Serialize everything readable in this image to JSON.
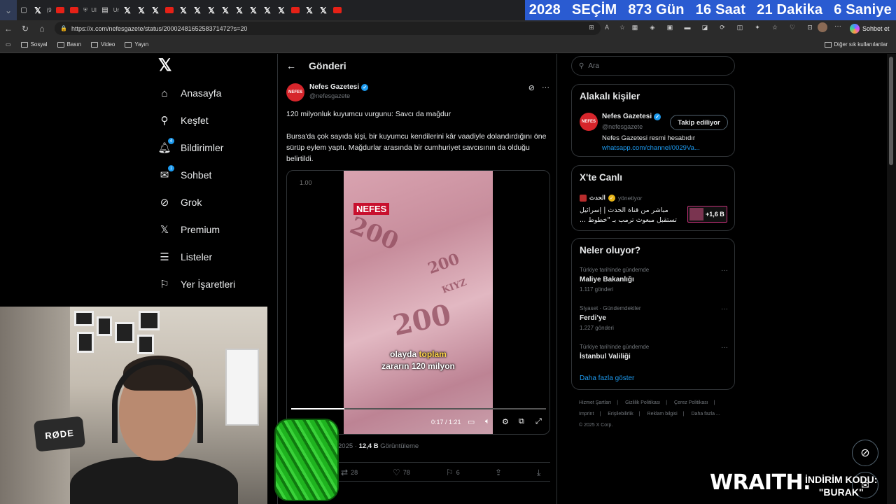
{
  "browser": {
    "tab_icon_count": 22,
    "countdown": [
      "2028",
      "SEÇİM",
      "873 Gün",
      "16 Saat",
      "21 Dakika",
      "6 Saniye"
    ],
    "url": "https://x.com/nefesgazete/status/2000248165258371472?s=20",
    "chat_label": "Sohbet et",
    "bookmarks": [
      "Sosyal",
      "Basın",
      "Video",
      "Yayın"
    ],
    "bookmarks_right": "Diğer sık kullanılanlar",
    "tab_labels": [
      "Ul",
      "Ur"
    ]
  },
  "nav": {
    "items": [
      {
        "label": "Anasayfa",
        "icon": "home-icon"
      },
      {
        "label": "Keşfet",
        "icon": "search-icon"
      },
      {
        "label": "Bildirimler",
        "icon": "bell-icon",
        "badge": "4"
      },
      {
        "label": "Sohbet",
        "icon": "mail-icon",
        "badge": "1"
      },
      {
        "label": "Grok",
        "icon": "grok-icon"
      },
      {
        "label": "Premium",
        "icon": "x-icon"
      },
      {
        "label": "Listeler",
        "icon": "list-icon"
      },
      {
        "label": "Yer İşaretleri",
        "icon": "bookmark-icon"
      }
    ]
  },
  "post": {
    "header_title": "Gönderi",
    "author_name": "Nefes Gazetesi",
    "author_handle": "@nefesgazete",
    "avatar_text": "NEFES",
    "headline": "120 milyonluk kuyumcu vurgunu: Savcı da mağdur",
    "body": "Bursa'da çok sayıda kişi, bir kuyumcu kendilerini kâr vaadiyle dolandırdığını öne sürüp eylem yaptı. Mağdurlar arasında bir cumhuriyet savcısının da olduğu belirtildi.",
    "video": {
      "corner_number": "1.00",
      "logo": "NEFES",
      "caption_pre": "olayda ",
      "caption_hl": "toplam",
      "caption_line2": "zararın 120 milyon",
      "time": "0:17 / 1:21",
      "progress": 0.21,
      "bill_numbers": [
        "200",
        "200",
        "200",
        "KIYZ"
      ]
    },
    "date_fragment": "2025 · ",
    "views_count": "12,4 B",
    "views_label": "Görüntüleme",
    "stats": {
      "retweets": "28",
      "likes": "78",
      "bookmarks": "6"
    }
  },
  "sidebar": {
    "search_placeholder": "Ara",
    "related_title": "Alakalı kişiler",
    "related": {
      "name": "Nefes Gazetesi",
      "handle": "@nefesgazete",
      "follow_label": "Takip ediliyor",
      "bio": "Nefes Gazetesi resmi hesabıdır",
      "link": "whatsapp.com/channel/0029Va..."
    },
    "live_title": "X'te Canlı",
    "live": {
      "host": "الحدث",
      "host_role": "yönetiyor",
      "title": "مباشر من قناة الحدث | إسرائيل تستقبل مبعوث ترمب بـ \"خطوط ...",
      "count": "+1,6 B"
    },
    "trends_title": "Neler oluyor?",
    "trends": [
      {
        "category": "Türkiye tarihinde gündemde",
        "title": "Maliye Bakanlığı",
        "count": "1.117 gönderi"
      },
      {
        "category": "Siyaset · Gündemdekiler",
        "title": "Ferdi'ye",
        "count": "1.227 gönderi"
      },
      {
        "category": "Türkiye tarihinde gündemde",
        "title": "İstanbul Valiliği",
        "count": ""
      }
    ],
    "show_more": "Daha fazla göster",
    "footer": [
      "Hizmet Şartları",
      "Gizlilik Politikası",
      "Çerez Politikası",
      "Imprint",
      "Erişilebilirlik",
      "Reklam bilgisi",
      "Daha fazla ...",
      "© 2025 X Corp."
    ]
  },
  "overlay": {
    "mic_brand": "RØDE",
    "sponsor": "WRAITH.",
    "code_line1": "İNDİRİM KODU:",
    "code_line2": "\"BURAK\""
  },
  "colors": {
    "accent": "#1d9bf0",
    "countdown_bg": "#2a5bd1",
    "nefes_red": "#c8102e"
  }
}
